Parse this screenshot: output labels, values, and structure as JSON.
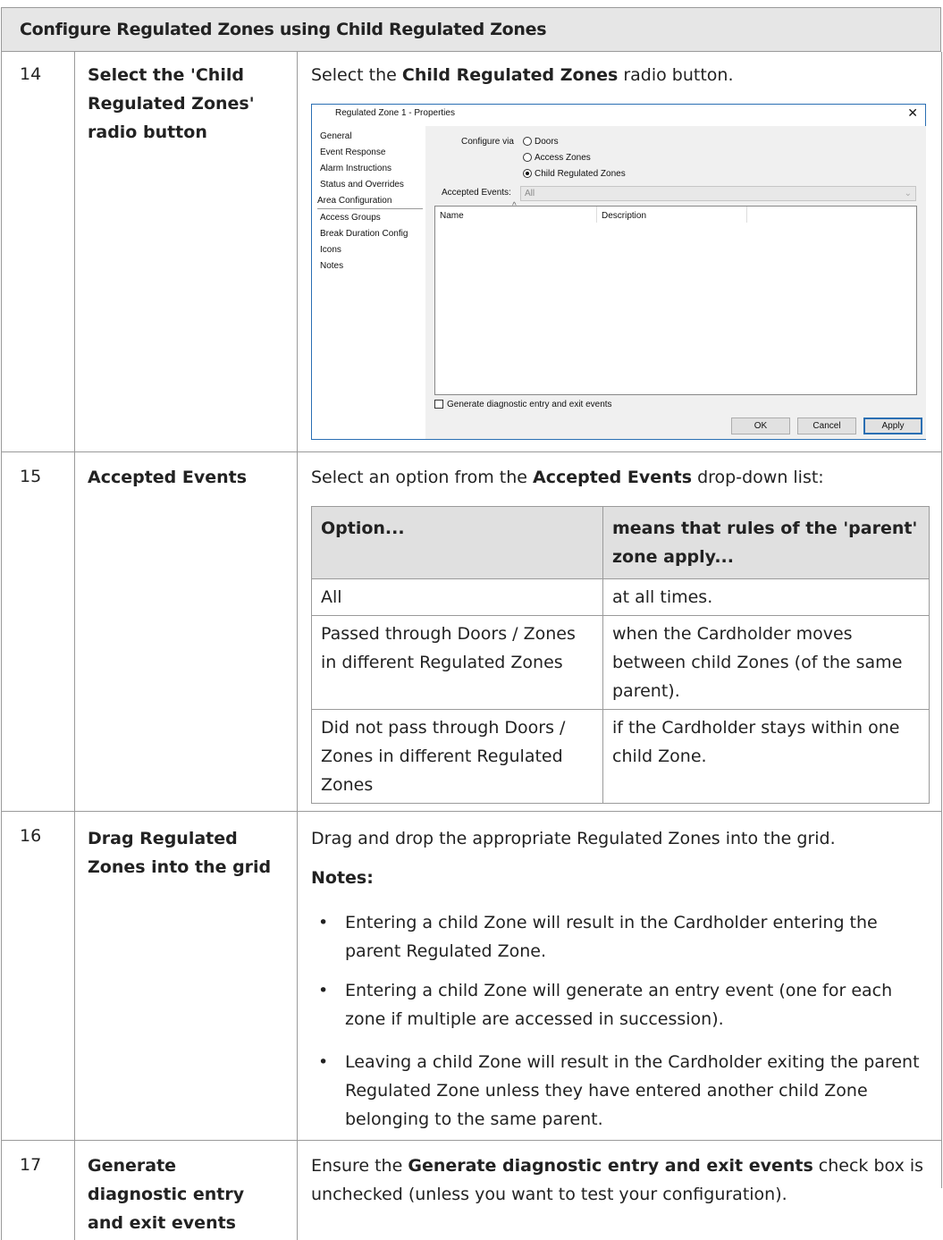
{
  "section_title": "Configure Regulated Zones using Child Regulated Zones",
  "steps": [
    {
      "num": "14",
      "name": "Select the 'Child Regulated Zones' radio button",
      "text_pre": "Select the ",
      "text_bold": "Child Regulated Zones",
      "text_post": " radio button."
    },
    {
      "num": "15",
      "name": "Accepted Events",
      "text_pre": "Select an option from the ",
      "text_bold": "Accepted Events",
      "text_post": " drop-down list:"
    },
    {
      "num": "16",
      "name": "Drag Regulated Zones into the grid",
      "text": "Drag and drop the appropriate Regulated Zones into the grid.",
      "notes_label": "Notes:",
      "notes": [
        "Entering a child Zone will result in the Cardholder entering the parent Regulated Zone.",
        "Entering a child Zone will generate an entry event (one for each zone if multiple are accessed in succession).",
        "Leaving a child Zone will result in the Cardholder exiting the parent Regulated Zone unless they have entered another child Zone belonging to the same parent."
      ]
    },
    {
      "num": "17",
      "name": "Generate diagnostic entry and exit events",
      "text_pre": "Ensure the ",
      "text_bold": "Generate diagnostic entry and exit events",
      "text_post": " check box is unchecked (unless you want to test your configuration)."
    }
  ],
  "dialog": {
    "title": "Regulated Zone 1 - Properties",
    "close_glyph": "✕",
    "nav": [
      "General",
      "Event Response",
      "Alarm Instructions",
      "Status and Overrides",
      "Area Configuration",
      "Access Groups",
      "Break Duration Config",
      "Icons",
      "Notes"
    ],
    "configure_via_label": "Configure via",
    "radios": [
      "Doors",
      "Access Zones",
      "Child Regulated Zones"
    ],
    "accepted_events_label": "Accepted Events:",
    "accepted_events_value": "All",
    "grid_columns": [
      "Name",
      "Description"
    ],
    "checkbox_label": "Generate diagnostic entry and exit events",
    "buttons": {
      "ok": "OK",
      "cancel": "Cancel",
      "apply": "Apply"
    }
  },
  "options_table": {
    "headers": [
      "Option...",
      "means that rules of the 'parent' zone apply..."
    ],
    "rows": [
      [
        "All",
        "at all times."
      ],
      [
        "Passed through Doors / Zones in different Regulated Zones",
        "when the Cardholder moves between child Zones (of the same parent)."
      ],
      [
        "Did not pass through Doors / Zones in different Regulated Zones",
        "if the Cardholder stays within one child Zone."
      ]
    ]
  },
  "bullet_glyph": "•"
}
